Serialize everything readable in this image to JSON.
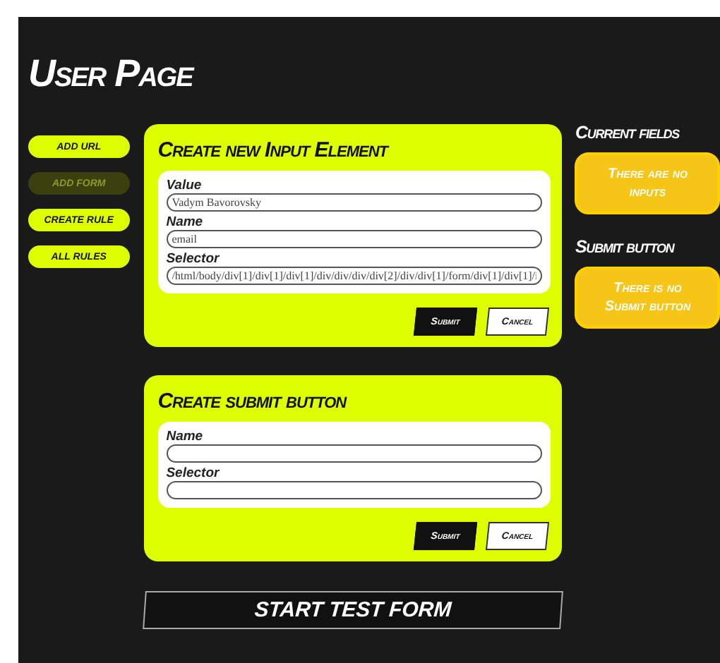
{
  "title": "User Page",
  "nav": [
    {
      "label": "ADD URL",
      "disabled": false
    },
    {
      "label": "ADD FORM",
      "disabled": true
    },
    {
      "label": "CREATE RULE",
      "disabled": false
    },
    {
      "label": "ALL RULES",
      "disabled": false
    }
  ],
  "panels": [
    {
      "title": "Create new Input Element",
      "fields": [
        {
          "label": "Value",
          "value": "Vadym Bavorovsky"
        },
        {
          "label": "Name",
          "value": "email"
        },
        {
          "label": "Selector",
          "value": "/html/body/div[1]/div[1]/div[1]/div/div/div/div[2]/div/div[1]/form/div[1]/div[1]/i"
        }
      ],
      "buttons": [
        {
          "label": "Submit",
          "kind": "primary"
        },
        {
          "label": "Cancel",
          "kind": "secondary"
        }
      ]
    },
    {
      "title": "Create submit button",
      "fields": [
        {
          "label": "Name"
        },
        {
          "label": "Selector"
        }
      ],
      "buttons": [
        {
          "label": "Submit",
          "kind": "primary"
        },
        {
          "label": "Cancel",
          "kind": "secondary"
        }
      ]
    }
  ],
  "start_button": "START TEST FORM",
  "side": [
    {
      "heading": "Current fields",
      "message": "There are no inputs"
    },
    {
      "heading": "Submit button",
      "message": "There is no Submit button"
    }
  ]
}
